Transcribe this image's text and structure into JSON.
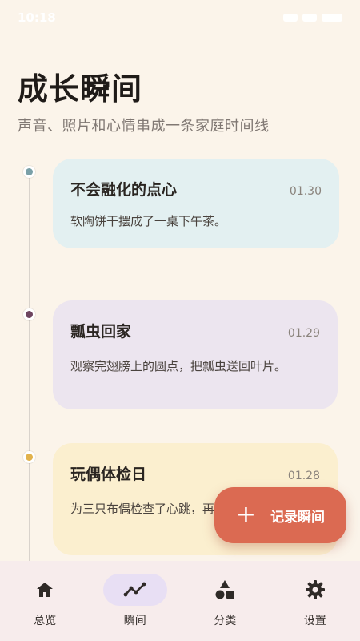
{
  "status_bar": {
    "time": "10:18"
  },
  "header": {
    "title": "成长瞬间",
    "subtitle": "声音、照片和心情串成一条家庭时间线"
  },
  "colors": {
    "accent": "#db6a52",
    "card_1_bg": "#e3f0f1",
    "card_2_bg": "#ece5ef",
    "card_3_bg": "#fbefcf",
    "dot_1": "#7aa0a8",
    "dot_2": "#6e4560",
    "dot_3": "#e2b24c"
  },
  "timeline": [
    {
      "title": "不会融化的点心",
      "date": "01.30",
      "body": "软陶饼干摆成了一桌下午茶。"
    },
    {
      "title": "瓢虫回家",
      "date": "01.29",
      "body": "观察完翅膀上的圆点，把瓢虫送回叶片。"
    },
    {
      "title": "玩偶体检日",
      "date": "01.28",
      "body": "为三只布偶检查了心跳，再哄它们点睡。"
    }
  ],
  "fab": {
    "label": "记录瞬间",
    "icon": "plus-icon"
  },
  "nav": [
    {
      "label": "总览",
      "icon": "home-icon",
      "active": false
    },
    {
      "label": "瞬间",
      "icon": "trend-icon",
      "active": true
    },
    {
      "label": "分类",
      "icon": "shapes-icon",
      "active": false
    },
    {
      "label": "设置",
      "icon": "gear-icon",
      "active": false
    }
  ]
}
